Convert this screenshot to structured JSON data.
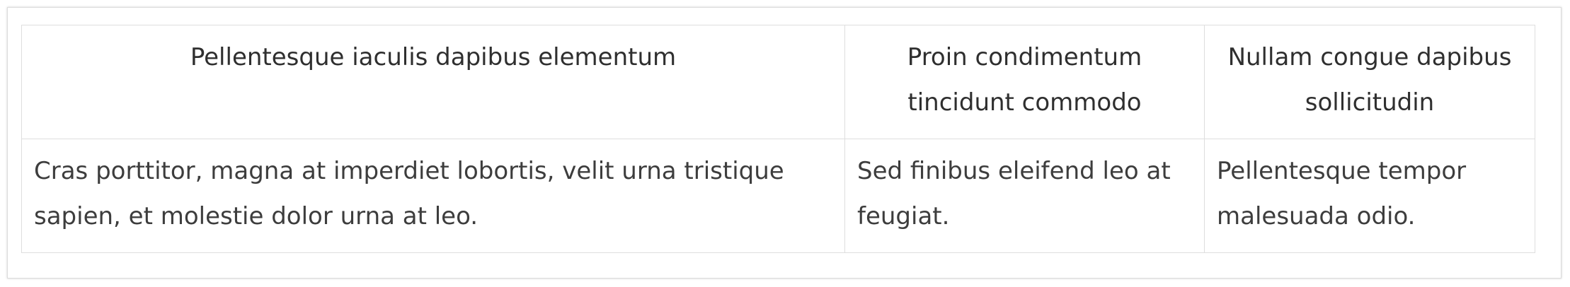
{
  "table": {
    "headers": [
      "Pellentesque iaculis dapibus elementum",
      "Proin condimentum tincidunt commodo",
      "Nullam congue dapibus sollicitudin"
    ],
    "rows": [
      [
        "Cras porttitor, magna at imperdiet lobortis, velit urna tristique sapien, et molestie dolor urna at leo.",
        "Sed finibus eleifend leo at feugiat.",
        "Pellentesque tempor malesuada odio."
      ]
    ]
  },
  "colors": {
    "border": "#dedede",
    "text": "#3a3a3a",
    "background": "#ffffff"
  }
}
